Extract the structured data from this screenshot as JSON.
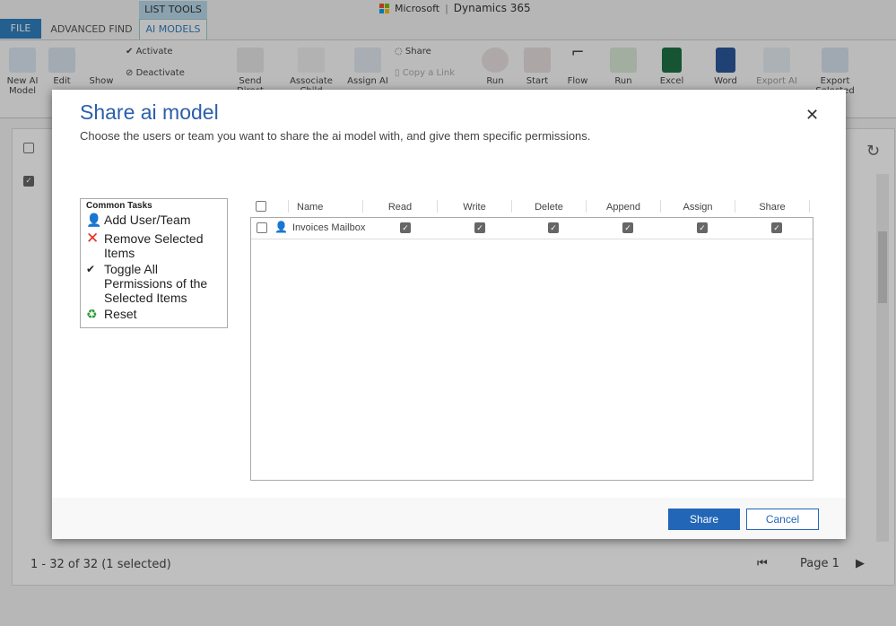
{
  "app": {
    "brand": "Microsoft",
    "product": "Dynamics 365"
  },
  "tabs": {
    "file": "FILE",
    "advanced_find": "ADVANCED FIND",
    "list_tools": "LIST TOOLS",
    "ai_models": "AI MODELS"
  },
  "ribbon": {
    "new_ai_model": "New AI Model",
    "edit": "Edit",
    "show": "Show",
    "activate": "Activate",
    "deactivate": "Deactivate",
    "send_direct": "Send Direct",
    "associate_child": "Associate Child",
    "assign_ai": "Assign AI",
    "share": "Share",
    "copy_link": "Copy a Link",
    "run_workflow": "Run",
    "start": "Start",
    "flow": "Flow",
    "run_report": "Run",
    "excel": "Excel",
    "word": "Word",
    "export_ai": "Export AI",
    "export_selected": "Export Selected"
  },
  "status": {
    "record_count": "1 - 32 of 32 (1 selected)",
    "page": "Page 1"
  },
  "dialog": {
    "title": "Share ai model",
    "subtitle": "Choose the users or team you want to share the ai model with, and give them specific permissions.",
    "common_tasks": {
      "heading": "Common Tasks",
      "items": [
        {
          "label": "Add User/Team",
          "icon": "user-icon"
        },
        {
          "label": "Remove Selected Items",
          "icon": "red-x-icon"
        },
        {
          "label": "Toggle All Permissions of the Selected Items",
          "icon": "checkmark-icon"
        },
        {
          "label": "Reset",
          "icon": "reset-icon"
        }
      ]
    },
    "grid": {
      "columns": [
        "Name",
        "Read",
        "Write",
        "Delete",
        "Append",
        "Assign",
        "Share"
      ],
      "rows": [
        {
          "name": "Invoices Mailbox",
          "selected": false,
          "read": true,
          "write": true,
          "delete": true,
          "append": true,
          "assign": true,
          "share": true
        }
      ]
    },
    "buttons": {
      "share": "Share",
      "cancel": "Cancel"
    },
    "colors": {
      "title": "#2b5faa",
      "primary_button": "#2266b8"
    }
  }
}
